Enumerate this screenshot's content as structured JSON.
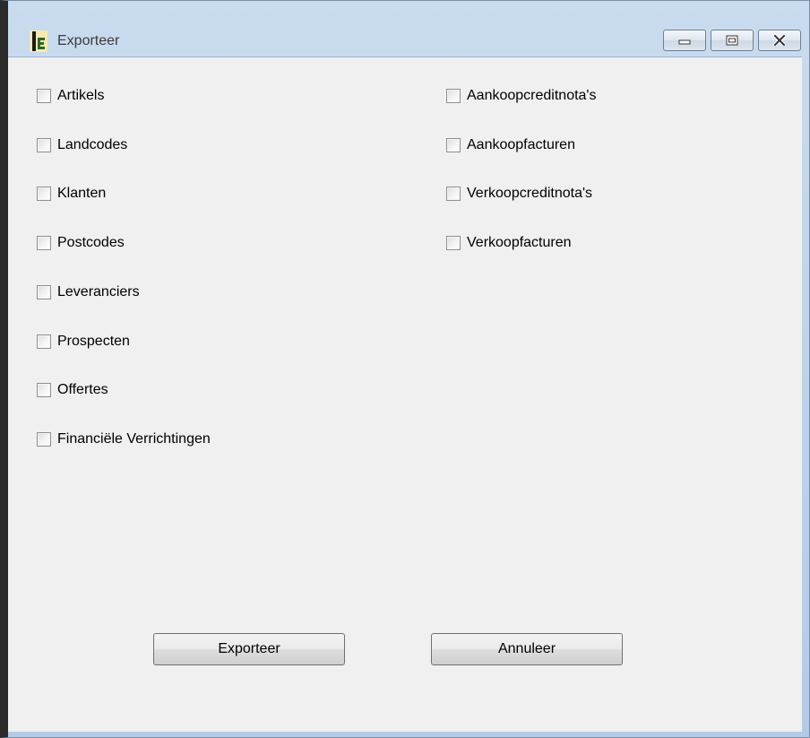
{
  "window": {
    "title": "Exporteer"
  },
  "checkboxes_left": [
    {
      "label": "Artikels",
      "checked": false
    },
    {
      "label": "Landcodes",
      "checked": false
    },
    {
      "label": "Klanten",
      "checked": false
    },
    {
      "label": "Postcodes",
      "checked": false
    },
    {
      "label": "Leveranciers",
      "checked": false
    },
    {
      "label": "Prospecten",
      "checked": false
    },
    {
      "label": "Offertes",
      "checked": false
    },
    {
      "label": "Financiële Verrichtingen",
      "checked": false
    }
  ],
  "checkboxes_right": [
    {
      "label": "Aankoopcreditnota's",
      "checked": false
    },
    {
      "label": "Aankoopfacturen",
      "checked": false
    },
    {
      "label": "Verkoopcreditnota's",
      "checked": false
    },
    {
      "label": "Verkoopfacturen",
      "checked": false
    }
  ],
  "buttons": {
    "export_label": "Exporteer",
    "cancel_label": "Annuleer"
  },
  "icons": {
    "app": "app-logo-icon",
    "minimize": "minimize-icon",
    "maximize": "maximize-icon",
    "close": "close-icon"
  }
}
